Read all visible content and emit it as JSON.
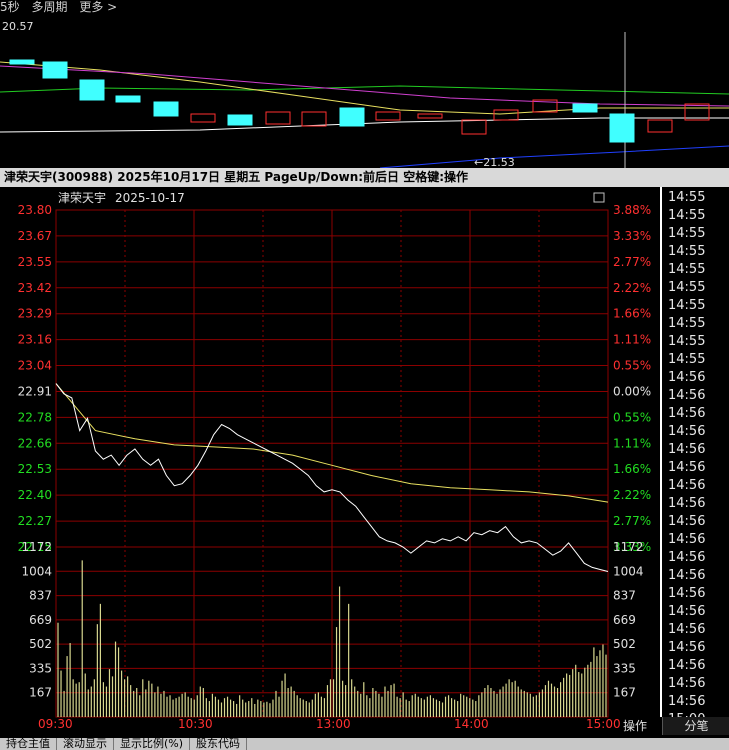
{
  "topbar": {
    "period": "5秒",
    "multi": "多周期",
    "more": "更多 >",
    "price_high": "20.57"
  },
  "kline_low_label": "←21.53",
  "infobar": {
    "text": "津荣天宇(300988)  2025年10月17日 星期五 PageUp/Down:前后日 空格键:操作"
  },
  "chart_title": {
    "name": "津荣天宇",
    "date": "2025-10-17"
  },
  "colors": {
    "up": "#ff3030",
    "down": "#22dd22",
    "price_line": "#ffffff",
    "avg_line": "#e8e060",
    "volume": "#d8d890",
    "grid": "#8b0000",
    "flat": "#e0e0e0"
  },
  "chart_data": {
    "type": "line",
    "price_axis": {
      "ticks": [
        "23.80",
        "23.67",
        "23.55",
        "23.42",
        "23.29",
        "23.16",
        "23.04",
        "22.91",
        "22.78",
        "22.66",
        "22.53",
        "22.40",
        "22.27",
        "22.15"
      ],
      "pct": [
        "3.88%",
        "3.33%",
        "2.77%",
        "2.22%",
        "1.66%",
        "1.11%",
        "0.55%",
        "0.00%",
        "0.55%",
        "1.11%",
        "1.66%",
        "2.22%",
        "2.77%",
        "3.33%"
      ],
      "ylim": [
        22.15,
        23.8
      ],
      "prev_close": 22.91
    },
    "time_labels": [
      "09:30",
      "10:30",
      "13:00",
      "14:00",
      "15:00"
    ],
    "price": [
      [
        0,
        22.95
      ],
      [
        4,
        22.9
      ],
      [
        8,
        22.88
      ],
      [
        12,
        22.72
      ],
      [
        16,
        22.78
      ],
      [
        20,
        22.62
      ],
      [
        24,
        22.58
      ],
      [
        28,
        22.6
      ],
      [
        32,
        22.55
      ],
      [
        36,
        22.6
      ],
      [
        40,
        22.63
      ],
      [
        44,
        22.58
      ],
      [
        48,
        22.55
      ],
      [
        52,
        22.58
      ],
      [
        56,
        22.5
      ],
      [
        60,
        22.45
      ],
      [
        64,
        22.46
      ],
      [
        68,
        22.5
      ],
      [
        72,
        22.55
      ],
      [
        76,
        22.62
      ],
      [
        80,
        22.7
      ],
      [
        84,
        22.75
      ],
      [
        88,
        22.73
      ],
      [
        92,
        22.7
      ],
      [
        96,
        22.68
      ],
      [
        100,
        22.66
      ],
      [
        104,
        22.64
      ],
      [
        108,
        22.62
      ],
      [
        112,
        22.6
      ],
      [
        116,
        22.58
      ],
      [
        120,
        22.56
      ],
      [
        124,
        22.53
      ],
      [
        128,
        22.5
      ],
      [
        132,
        22.45
      ],
      [
        136,
        22.42
      ],
      [
        140,
        22.43
      ],
      [
        144,
        22.42
      ],
      [
        148,
        22.38
      ],
      [
        152,
        22.35
      ],
      [
        156,
        22.3
      ],
      [
        160,
        22.25
      ],
      [
        164,
        22.2
      ],
      [
        168,
        22.18
      ],
      [
        172,
        22.17
      ],
      [
        176,
        22.15
      ],
      [
        180,
        22.12
      ],
      [
        184,
        22.15
      ],
      [
        188,
        22.18
      ],
      [
        192,
        22.17
      ],
      [
        196,
        22.19
      ],
      [
        200,
        22.18
      ],
      [
        204,
        22.2
      ],
      [
        208,
        22.18
      ],
      [
        212,
        22.22
      ],
      [
        216,
        22.21
      ],
      [
        220,
        22.23
      ],
      [
        224,
        22.22
      ],
      [
        228,
        22.25
      ],
      [
        232,
        22.2
      ],
      [
        236,
        22.17
      ],
      [
        240,
        22.18
      ],
      [
        244,
        22.17
      ],
      [
        248,
        22.14
      ],
      [
        252,
        22.11
      ],
      [
        256,
        22.13
      ],
      [
        260,
        22.17
      ],
      [
        264,
        22.12
      ],
      [
        268,
        22.07
      ],
      [
        272,
        22.05
      ],
      [
        276,
        22.04
      ],
      [
        280,
        22.03
      ]
    ],
    "avg": [
      [
        0,
        22.95
      ],
      [
        20,
        22.72
      ],
      [
        40,
        22.68
      ],
      [
        60,
        22.65
      ],
      [
        80,
        22.64
      ],
      [
        100,
        22.63
      ],
      [
        120,
        22.6
      ],
      [
        140,
        22.55
      ],
      [
        160,
        22.5
      ],
      [
        180,
        22.46
      ],
      [
        200,
        22.44
      ],
      [
        220,
        22.43
      ],
      [
        240,
        22.42
      ],
      [
        260,
        22.4
      ],
      [
        280,
        22.37
      ]
    ],
    "volume_axis": {
      "ticks": [
        "1172",
        "1004",
        "837",
        "669",
        "502",
        "335",
        "167"
      ],
      "ylim": [
        0,
        1172
      ]
    },
    "volume": [
      650,
      320,
      180,
      420,
      510,
      260,
      230,
      240,
      1080,
      300,
      190,
      210,
      260,
      640,
      780,
      240,
      210,
      330,
      280,
      520,
      480,
      320,
      260,
      280,
      220,
      180,
      200,
      150,
      260,
      190,
      250,
      230,
      170,
      210,
      160,
      180,
      140,
      150,
      120,
      130,
      140,
      160,
      170,
      140,
      130,
      120,
      150,
      210,
      200,
      130,
      110,
      160,
      140,
      120,
      100,
      130,
      140,
      120,
      110,
      90,
      150,
      120,
      100,
      110,
      130,
      90,
      120,
      110,
      100,
      105,
      95,
      120,
      180,
      140,
      250,
      300,
      200,
      210,
      180,
      150,
      130,
      120,
      110,
      100,
      120,
      160,
      170,
      140,
      130,
      220,
      260,
      260,
      620,
      900,
      250,
      220,
      780,
      260,
      210,
      180,
      160,
      240,
      150,
      130,
      200,
      180,
      160,
      140,
      210,
      180,
      220,
      230,
      140,
      130,
      170,
      120,
      110,
      150,
      160,
      140,
      130,
      120,
      140,
      150,
      130,
      120,
      110,
      100,
      140,
      150,
      130,
      120,
      110,
      160,
      150,
      140,
      130,
      120,
      110,
      150,
      170,
      200,
      220,
      200,
      180,
      160,
      190,
      210,
      230,
      260,
      240,
      250,
      210,
      190,
      180,
      170,
      160,
      140,
      150,
      170,
      190,
      220,
      250,
      230,
      210,
      200,
      240,
      270,
      300,
      290,
      330,
      360,
      310,
      300,
      340,
      360,
      380,
      480,
      420,
      460,
      500,
      430
    ]
  },
  "time_ticks": [
    "14:55",
    "14:55",
    "14:55",
    "14:55",
    "14:55",
    "14:55",
    "14:55",
    "14:55",
    "14:55",
    "14:55",
    "14:56",
    "14:56",
    "14:56",
    "14:56",
    "14:56",
    "14:56",
    "14:56",
    "14:56",
    "14:56",
    "14:56",
    "14:56",
    "14:56",
    "14:56",
    "14:56",
    "14:56",
    "14:56",
    "14:56",
    "14:56",
    "14:56",
    "15:00"
  ],
  "buttons": {
    "operate": "操作",
    "trades": "分笔"
  },
  "bottom_tabs": [
    "持仓主值",
    "滚动显示",
    "显示比例(%)",
    "股东代码"
  ]
}
